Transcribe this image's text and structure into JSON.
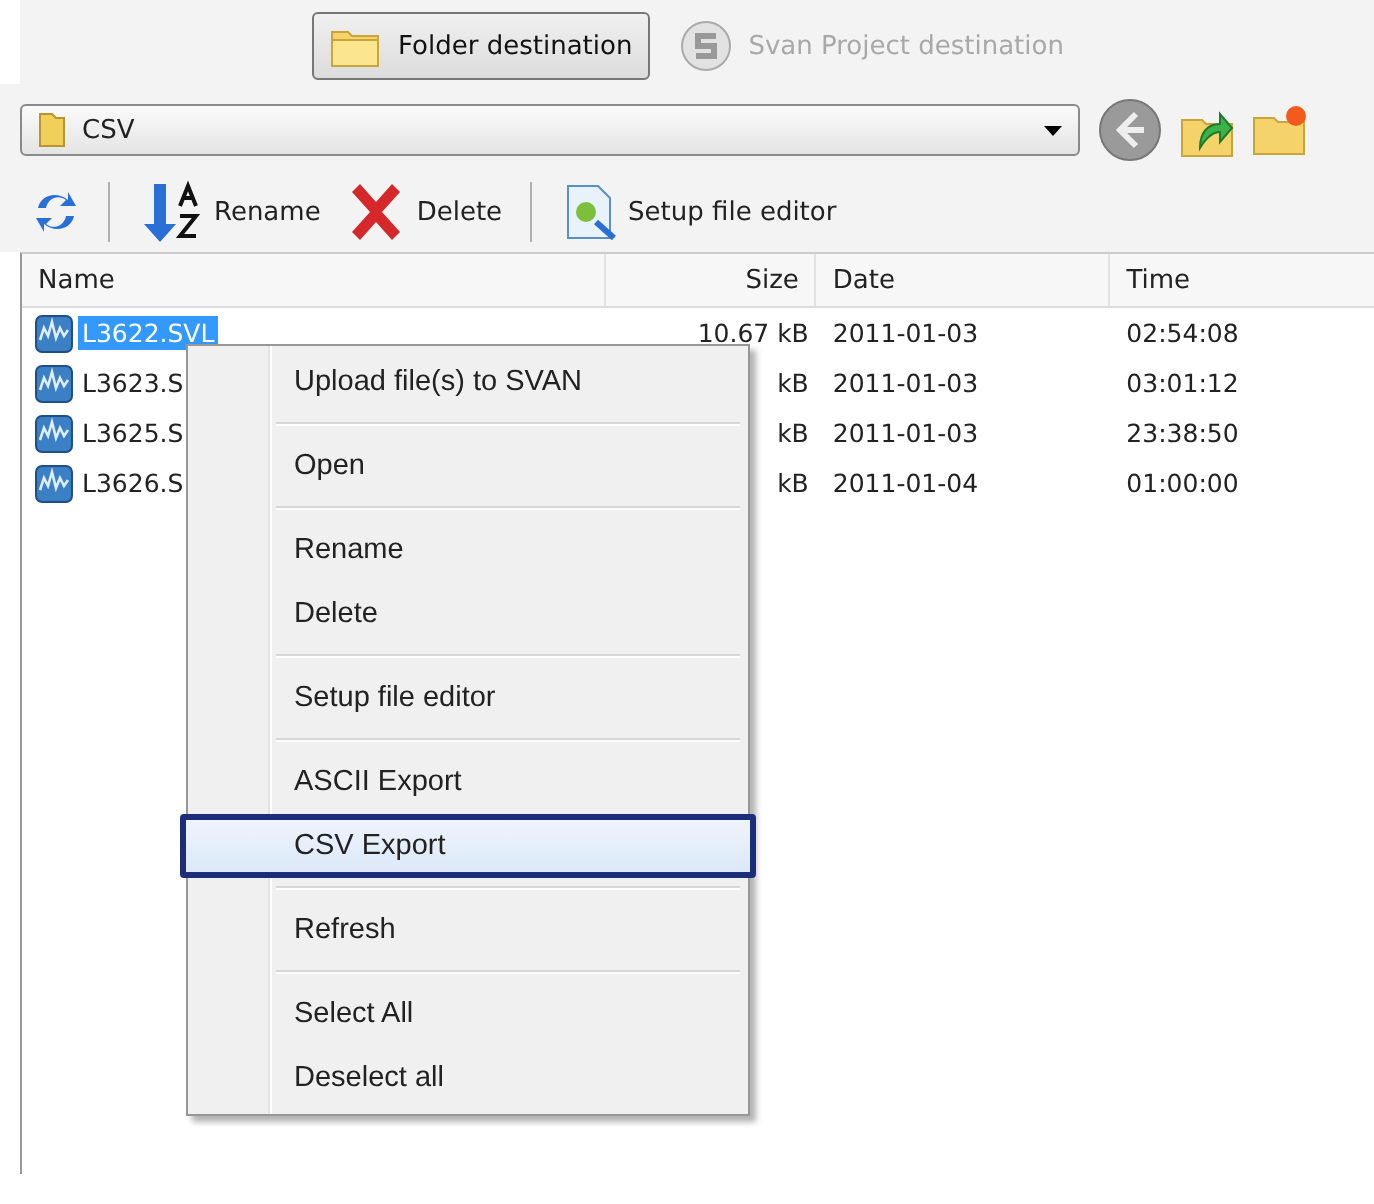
{
  "destinations": [
    {
      "label": "Folder destination",
      "kind": "folder",
      "selected": true
    },
    {
      "label": "Svan Project destination",
      "kind": "svan",
      "selected": false
    }
  ],
  "path": {
    "value": "CSV"
  },
  "toolbar": [
    {
      "kind": "refresh"
    },
    {
      "kind": "rename",
      "label": "Rename"
    },
    {
      "kind": "delete",
      "label": "Delete"
    },
    {
      "kind": "setup",
      "label": "Setup file editor"
    }
  ],
  "table": {
    "columns": [
      "Name",
      "Size",
      "Date",
      "Time"
    ],
    "rows": [
      {
        "name": "L3622.SVL",
        "size": "10.67 kB",
        "date": "2011-01-03",
        "time": "02:54:08",
        "selected": true
      },
      {
        "name": "L3623.S",
        "size": "kB",
        "date": "2011-01-03",
        "time": "03:01:12",
        "selected": false
      },
      {
        "name": "L3625.S",
        "size": "kB",
        "date": "2011-01-03",
        "time": "23:38:50",
        "selected": false
      },
      {
        "name": "L3626.S",
        "size": "kB",
        "date": "2011-01-04",
        "time": "01:00:00",
        "selected": false
      }
    ]
  },
  "context_menu": {
    "groups": [
      [
        {
          "label": "Upload file(s) to SVAN",
          "selected": false
        }
      ],
      [
        {
          "label": "Open",
          "selected": false
        }
      ],
      [
        {
          "label": "Rename",
          "selected": false
        },
        {
          "label": "Delete",
          "selected": false
        }
      ],
      [
        {
          "label": "Setup file editor",
          "selected": false
        }
      ],
      [
        {
          "label": "ASCII Export",
          "selected": false
        },
        {
          "label": "CSV Export",
          "selected": true
        }
      ],
      [
        {
          "label": "Refresh",
          "selected": false
        }
      ],
      [
        {
          "label": "Select All",
          "selected": false
        },
        {
          "label": "Deselect all",
          "selected": false
        }
      ]
    ]
  }
}
